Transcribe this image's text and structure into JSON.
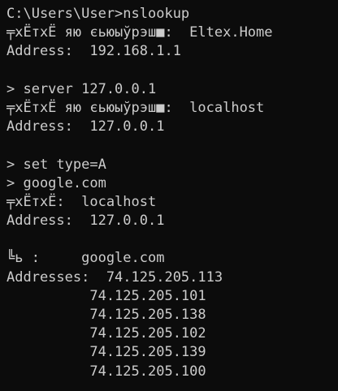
{
  "terminal": {
    "colors": {
      "background": "#0c0c0c",
      "foreground": "#cccccc"
    },
    "lines": [
      "C:\\Users\\User>nslookup",
      "╤хЁтхЁ яю єьюыўрэш■:  Eltex.Home",
      "Address:  192.168.1.1",
      "",
      "> server 127.0.0.1",
      "╤хЁтхЁ яю єьюыўрэш■:  localhost",
      "Address:  127.0.0.1",
      "",
      "> set type=A",
      "> google.com",
      "╤хЁтхЁ:  localhost",
      "Address:  127.0.0.1",
      "",
      "╚ь :     google.com",
      "Addresses:  74.125.205.113",
      "          74.125.205.101",
      "          74.125.205.138",
      "          74.125.205.102",
      "          74.125.205.139",
      "          74.125.205.100"
    ]
  }
}
